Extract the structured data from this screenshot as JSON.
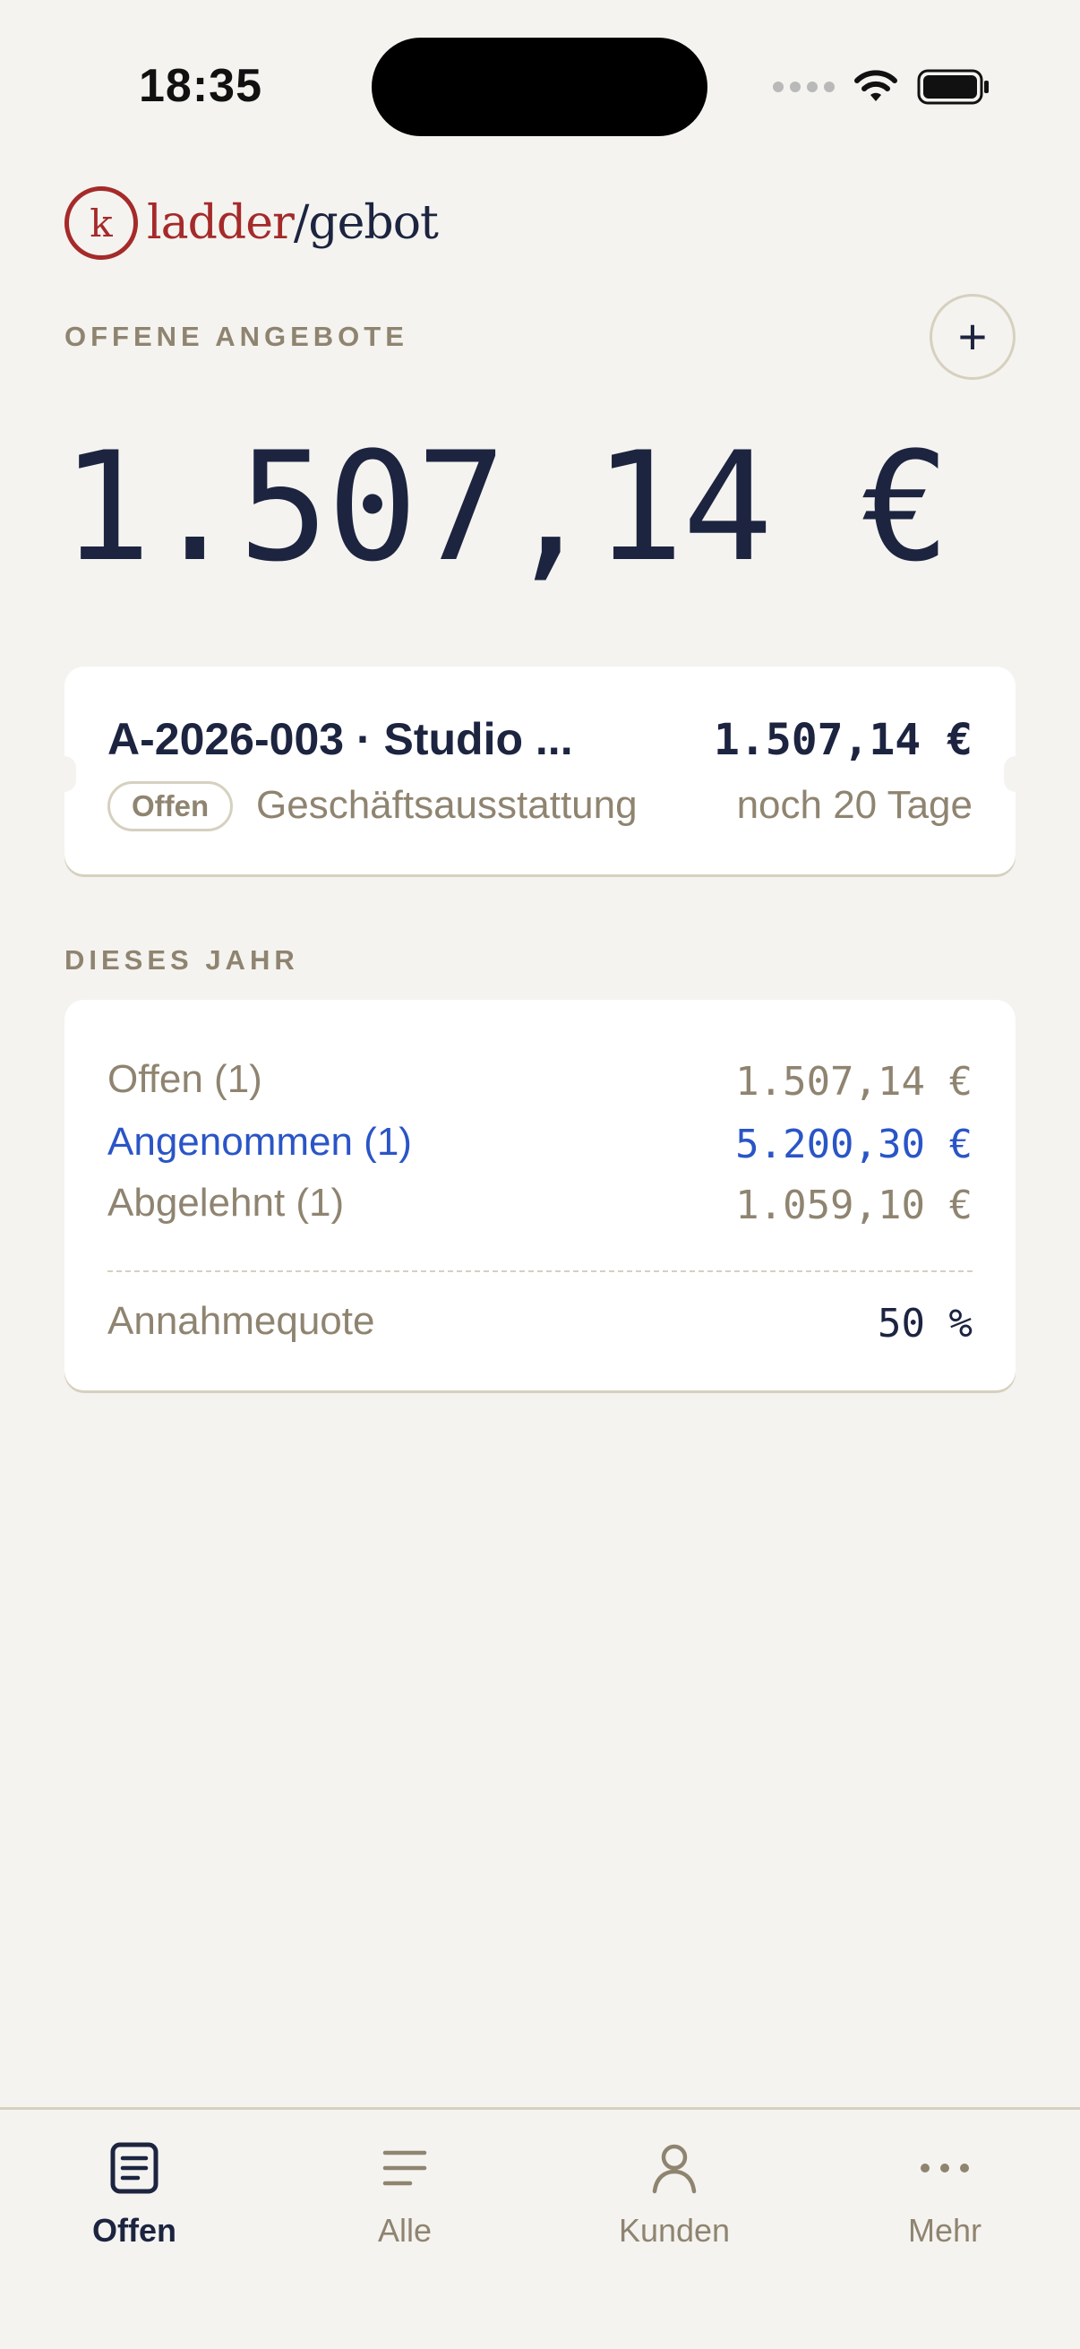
{
  "status_bar": {
    "time": "18:35"
  },
  "header": {
    "logo_letter": "k",
    "logo_brand": "ladder",
    "logo_separator": "/",
    "logo_product": "gebot",
    "section_label": "OFFENE ANGEBOTE",
    "add_button": "+",
    "total": "1.507,14 €"
  },
  "offers": [
    {
      "title": "A-2026-003 · Studio ...",
      "amount": "1.507,14 €",
      "status": "Offen",
      "category": "Geschäftsausstattung",
      "due": "noch 20 Tage"
    }
  ],
  "year_section": {
    "label": "DIESES JAHR",
    "rows": [
      {
        "label": "Offen (1)",
        "value": "1.507,14 €"
      },
      {
        "label": "Angenommen (1)",
        "value": "5.200,30 €"
      },
      {
        "label": "Abgelehnt (1)",
        "value": "1.059,10 €"
      }
    ],
    "quote_label": "Annahmequote",
    "quote_value": "50 %"
  },
  "tabs": [
    {
      "label": "Offen",
      "icon": "document-icon",
      "active": true
    },
    {
      "label": "Alle",
      "icon": "list-icon",
      "active": false
    },
    {
      "label": "Kunden",
      "icon": "person-icon",
      "active": false
    },
    {
      "label": "Mehr",
      "icon": "more-icon",
      "active": false
    }
  ],
  "colors": {
    "background": "#f4f3ef",
    "primary": "#1c2440",
    "brand_red": "#a52a2a",
    "muted": "#8f8470",
    "accepted_blue": "#2a55c7"
  }
}
